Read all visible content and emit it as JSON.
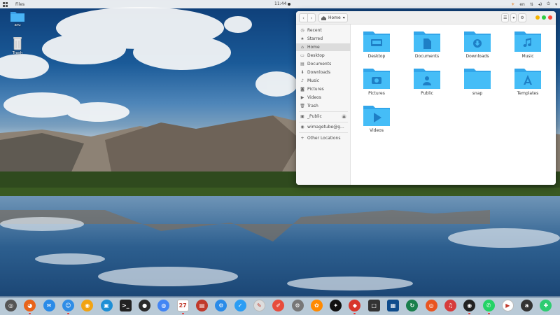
{
  "topbar": {
    "app_name": "Files",
    "clock": "11:44",
    "language": "en"
  },
  "desktop": {
    "icons": [
      {
        "label": "aru",
        "icon": "folder-icon"
      },
      {
        "label": "Trash",
        "icon": "trash-icon"
      }
    ]
  },
  "files_window": {
    "path_label": "Home",
    "sidebar": {
      "places": [
        "Recent",
        "Starred",
        "Home",
        "Desktop",
        "Documents",
        "Downloads",
        "Music",
        "Pictures",
        "Videos",
        "Trash"
      ],
      "devices": [
        "_Public"
      ],
      "network": [
        "wimagetube@g..."
      ],
      "other": "Other Locations"
    },
    "folders": [
      "Desktop",
      "Documents",
      "Downloads",
      "Music",
      "Pictures",
      "Public",
      "snap",
      "Templates",
      "Videos"
    ]
  },
  "dock": {
    "apps": [
      {
        "name": "launchpad",
        "color": "#555555",
        "glyph": "◎"
      },
      {
        "name": "firefox",
        "color": "#e8641b",
        "glyph": "◕"
      },
      {
        "name": "mail",
        "color": "#2a8be8",
        "glyph": "✉"
      },
      {
        "name": "finder",
        "color": "#2f8de6",
        "glyph": "☺"
      },
      {
        "name": "vlc-like",
        "color": "#f2a312",
        "glyph": "◉"
      },
      {
        "name": "screenshot",
        "color": "#1d8fd6",
        "glyph": "▣"
      },
      {
        "name": "terminal",
        "color": "#222222",
        "glyph": ">_"
      },
      {
        "name": "obs",
        "color": "#2b2b2b",
        "glyph": "●"
      },
      {
        "name": "chrome",
        "color": "#4285f4",
        "glyph": "◍"
      },
      {
        "name": "calendar",
        "color": "#ffffff",
        "glyph": "27"
      },
      {
        "name": "monitor",
        "color": "#c0392b",
        "glyph": "▤"
      },
      {
        "name": "settings-blue",
        "color": "#2a8be8",
        "glyph": "⚙"
      },
      {
        "name": "tasks",
        "color": "#2a9df4",
        "glyph": "✓"
      },
      {
        "name": "inkscape",
        "color": "#dddddd",
        "glyph": "✎"
      },
      {
        "name": "notes",
        "color": "#e74c3c",
        "glyph": "✐"
      },
      {
        "name": "system-settings",
        "color": "#777777",
        "glyph": "⚙"
      },
      {
        "name": "photos",
        "color": "#ff8a00",
        "glyph": "✿"
      },
      {
        "name": "ai-tool",
        "color": "#111111",
        "glyph": "✦"
      },
      {
        "name": "redis",
        "color": "#d8352a",
        "glyph": "◆"
      },
      {
        "name": "terminal-2",
        "color": "#333333",
        "glyph": "□"
      },
      {
        "name": "code",
        "color": "#0e4c8c",
        "glyph": "▦"
      },
      {
        "name": "timeshift",
        "color": "#1a7f4b",
        "glyph": "↻"
      },
      {
        "name": "ubuntu",
        "color": "#e95420",
        "glyph": "◎"
      },
      {
        "name": "music",
        "color": "#d63b3b",
        "glyph": "♫"
      },
      {
        "name": "obs-2",
        "color": "#222222",
        "glyph": "◉"
      },
      {
        "name": "whatsapp",
        "color": "#25d366",
        "glyph": "✆"
      },
      {
        "name": "media-player",
        "color": "#ffffff",
        "glyph": "▶"
      },
      {
        "name": "app-a",
        "color": "#333333",
        "glyph": "a"
      },
      {
        "name": "puzzle",
        "color": "#2ecc71",
        "glyph": "✚"
      }
    ]
  }
}
